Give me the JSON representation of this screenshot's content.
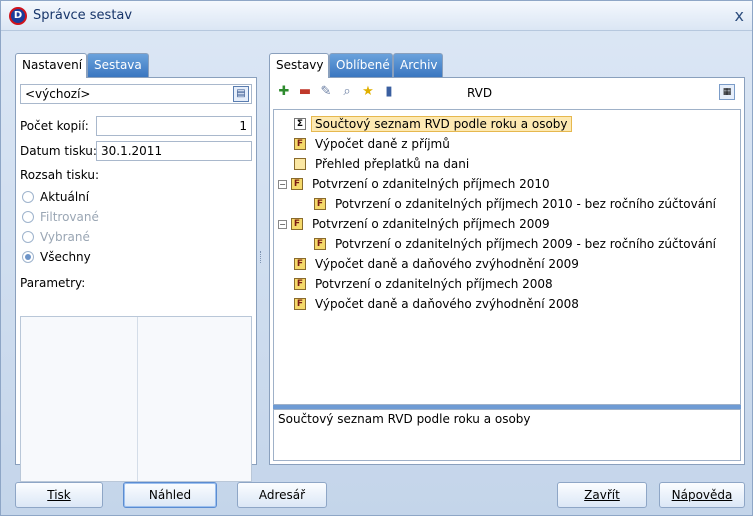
{
  "window": {
    "title": "Správce sestav",
    "logo_text": "D",
    "close_glyph": "x"
  },
  "left": {
    "tabs": [
      {
        "label": "Nastavení",
        "active": true
      },
      {
        "label": "Sestava",
        "active": false
      }
    ],
    "preset_value": "<výchozí>",
    "copies_label": "Počet kopií:",
    "copies_value": "1",
    "print_date_label": "Datum tisku:",
    "print_date_value": "30.1.2011",
    "range_label": "Rozsah tisku:",
    "radios": [
      {
        "label": "Aktuální",
        "checked": false,
        "disabled": false
      },
      {
        "label": "Filtrované",
        "checked": false,
        "disabled": true
      },
      {
        "label": "Vybrané",
        "checked": false,
        "disabled": true
      },
      {
        "label": "Všechny",
        "checked": true,
        "disabled": false
      }
    ],
    "params_label": "Parametry:"
  },
  "right": {
    "tabs": [
      {
        "label": "Sestavy",
        "active": true
      },
      {
        "label": "Oblíbené",
        "active": false
      },
      {
        "label": "Archiv",
        "active": false
      }
    ],
    "toolbar_icons": [
      "add-report-icon",
      "delete-report-icon",
      "edit-report-icon",
      "preview-report-icon",
      "favorite-star-icon",
      "report-info-icon"
    ],
    "toolbar_label": "RVD",
    "tree": [
      {
        "label": "Součtový seznam RVD podle roku a osoby",
        "level": 0,
        "icon": "sigma",
        "expander": "",
        "selected": true
      },
      {
        "label": "Výpočet daně z příjmů",
        "level": 0,
        "icon": "report",
        "expander": "",
        "selected": false
      },
      {
        "label": "Přehled přeplatků na dani",
        "level": 0,
        "icon": "blank",
        "expander": "",
        "selected": false
      },
      {
        "label": "Potvrzení o zdanitelných příjmech 2010",
        "level": 0,
        "icon": "report",
        "expander": "minus",
        "selected": false
      },
      {
        "label": "Potvrzení o zdanitelných příjmech 2010 - bez ročního zúčtování",
        "level": 1,
        "icon": "report",
        "expander": "",
        "selected": false
      },
      {
        "label": "Potvrzení o zdanitelných příjmech 2009",
        "level": 0,
        "icon": "report",
        "expander": "minus",
        "selected": false
      },
      {
        "label": "Potvrzení o zdanitelných příjmech 2009 - bez ročního zúčtování",
        "level": 1,
        "icon": "report",
        "expander": "",
        "selected": false
      },
      {
        "label": "Výpočet daně a daňového zvýhodnění 2009",
        "level": 0,
        "icon": "report",
        "expander": "",
        "selected": false
      },
      {
        "label": "Potvrzení o zdanitelných příjmech 2008",
        "level": 0,
        "icon": "report",
        "expander": "",
        "selected": false
      },
      {
        "label": "Výpočet daně a daňového zvýhodnění 2008",
        "level": 0,
        "icon": "report",
        "expander": "",
        "selected": false
      }
    ],
    "description": "Součtový seznam RVD podle roku a osoby"
  },
  "buttons": {
    "print": "Tisk",
    "preview": "Náhled",
    "folder": "Adresář",
    "close": "Zavřít",
    "help": "Nápověda"
  },
  "colors": {
    "accent": "#3a76c0",
    "selection": "#fde9b2"
  }
}
